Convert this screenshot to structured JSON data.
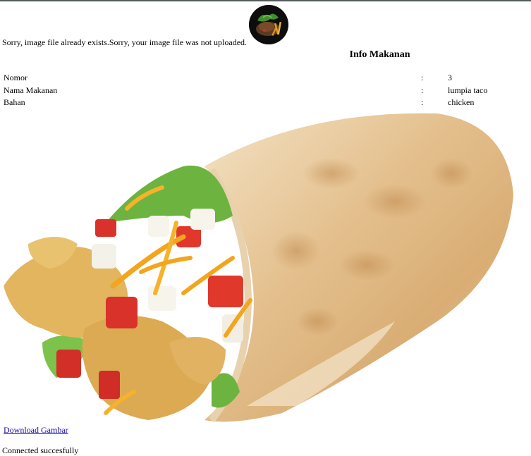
{
  "upload_message": "Sorry, image file already exists.Sorry, your image file was not uploaded.",
  "info": {
    "title": "Info Makanan",
    "separator": ":",
    "rows": [
      {
        "label": "Nomor",
        "value": "3"
      },
      {
        "label": "Nama Makanan",
        "value": "lumpia taco"
      },
      {
        "label": "Bahan",
        "value": "chicken"
      }
    ]
  },
  "download_label": "Download Gambar",
  "status": "Connected succesfully",
  "colors": {
    "link": "#1a0dab",
    "top_rule": "#555a5a"
  }
}
